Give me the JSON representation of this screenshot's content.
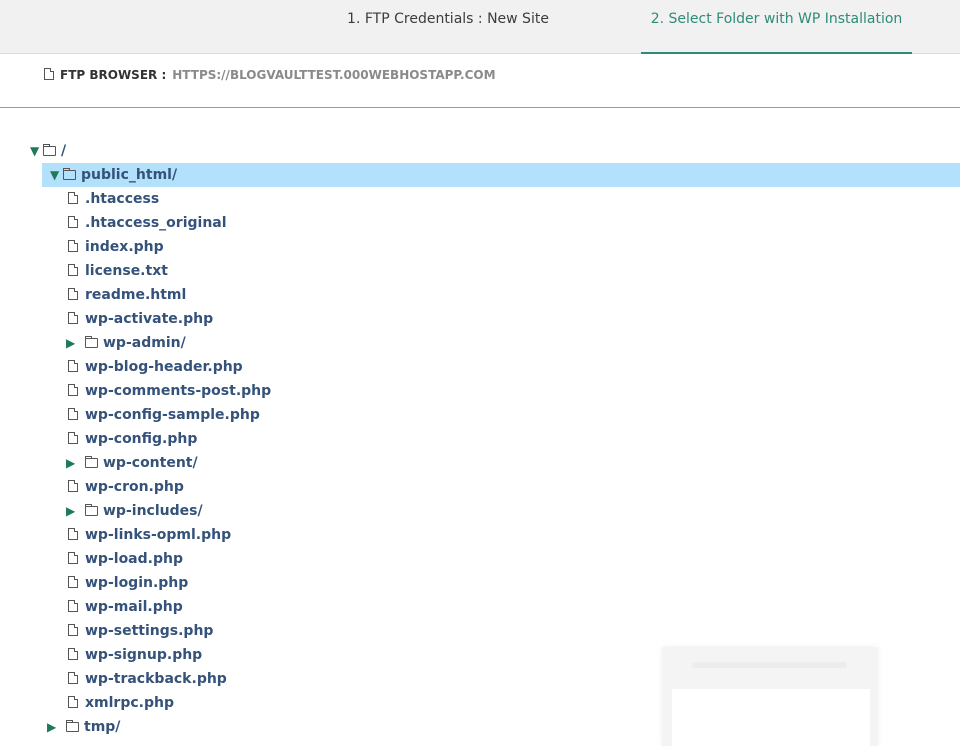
{
  "steps": {
    "step1": "1. FTP Credentials : New Site",
    "step2": "2. Select Folder with WP Installation"
  },
  "browser": {
    "label": "FTP BROWSER :",
    "url": "HTTPS://BLOGVAULTTEST.000WEBHOSTAPP.COM"
  },
  "tree": {
    "root": "/",
    "public_html": "public_html/",
    "items": {
      "htaccess": ".htaccess",
      "htaccess_original": ".htaccess_original",
      "index": "index.php",
      "license": "license.txt",
      "readme": "readme.html",
      "wp_activate": "wp-activate.php",
      "wp_admin": "wp-admin/",
      "wp_blog_header": "wp-blog-header.php",
      "wp_comments_post": "wp-comments-post.php",
      "wp_config_sample": "wp-config-sample.php",
      "wp_config": "wp-config.php",
      "wp_content": "wp-content/",
      "wp_cron": "wp-cron.php",
      "wp_includes": "wp-includes/",
      "wp_links_opml": "wp-links-opml.php",
      "wp_load": "wp-load.php",
      "wp_login": "wp-login.php",
      "wp_mail": "wp-mail.php",
      "wp_settings": "wp-settings.php",
      "wp_signup": "wp-signup.php",
      "wp_trackback": "wp-trackback.php",
      "xmlrpc": "xmlrpc.php"
    },
    "tmp": "tmp/"
  },
  "colors": {
    "accent": "#2e8b7a",
    "selected_row": "#b3e0fb",
    "file_text": "#34527a",
    "caret": "#1f7a5c"
  }
}
